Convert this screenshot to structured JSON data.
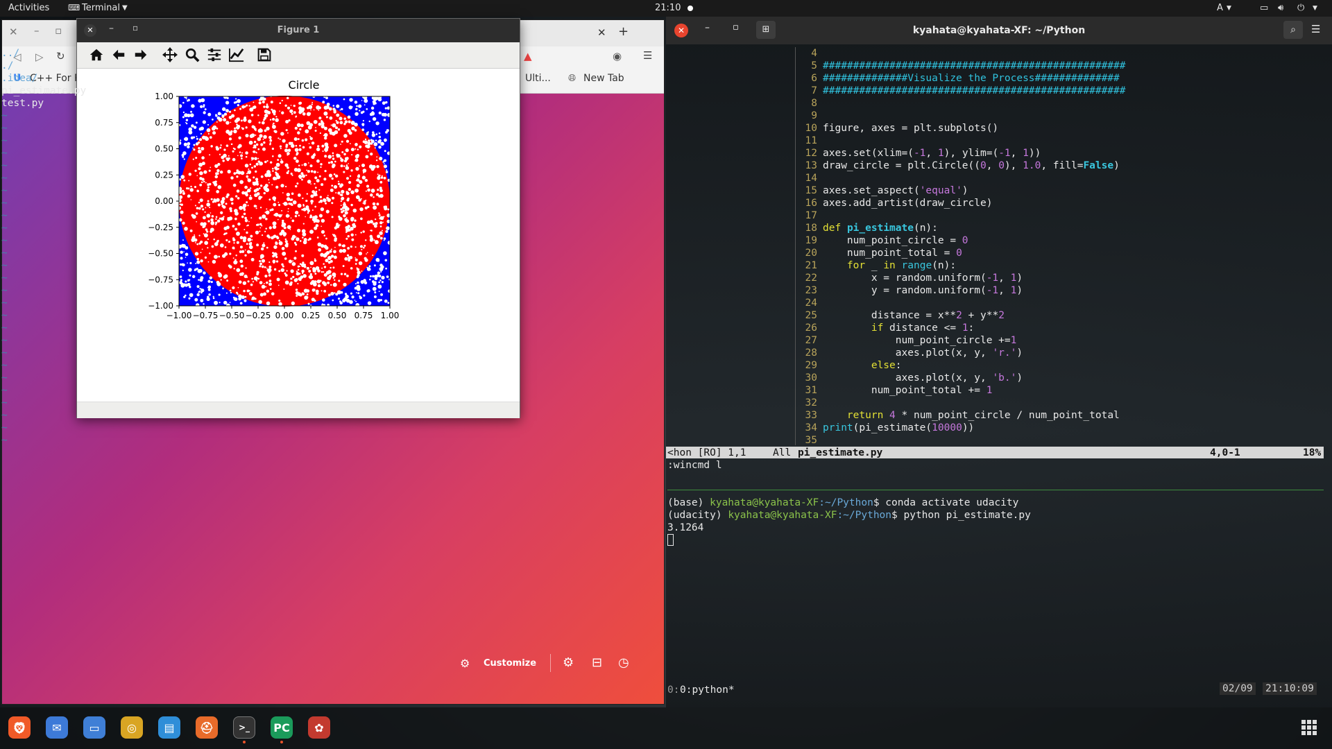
{
  "topbar": {
    "activities": "Activities",
    "app_menu": "Terminal",
    "clock": "21:10",
    "input_method": "A"
  },
  "dock": {
    "apps": [
      {
        "name": "brave",
        "color": "#f05a28"
      },
      {
        "name": "thunderbird",
        "color": "#3d7ad8"
      },
      {
        "name": "files",
        "color": "#3f7fd6"
      },
      {
        "name": "rhythmbox",
        "color": "#d9a523"
      },
      {
        "name": "libreoffice-writer",
        "color": "#2f8ed8"
      },
      {
        "name": "help",
        "color": "#e86b2a"
      },
      {
        "name": "terminal",
        "color": "#333333"
      },
      {
        "name": "pycharm",
        "color": "#1b9b5b"
      },
      {
        "name": "other",
        "color": "#c33a2f"
      }
    ]
  },
  "browser": {
    "bookmark_1": "C++ For Pr",
    "bookmark_2": "Ulti...",
    "new_tab": "New Tab",
    "customize": "Customize"
  },
  "figure": {
    "window_title": "Figure 1"
  },
  "chart_data": {
    "type": "scatter",
    "title": "Circle",
    "xlabel": "",
    "ylabel": "",
    "xlim": [
      -1.0,
      1.0
    ],
    "ylim": [
      -1.0,
      1.0
    ],
    "xticks": [
      "−1.00",
      "−0.75",
      "−0.50",
      "−0.25",
      "0.00",
      "0.25",
      "0.50",
      "0.75",
      "1.00"
    ],
    "yticks": [
      "1.00",
      "0.75",
      "0.50",
      "0.25",
      "0.00",
      "−0.25",
      "−0.50",
      "−0.75",
      "−1.00"
    ],
    "series": [
      {
        "color": "#ff0000",
        "region": "x^2 + y^2 <= 1"
      },
      {
        "color": "#0000ff",
        "region": "x^2 + y^2 > 1"
      }
    ],
    "grid": false,
    "aspect": "equal"
  },
  "terminal": {
    "title": "kyahata@kyahata-XF: ~/Python",
    "tree": [
      "../",
      "./",
      ".idea/",
      "pi_estimate.py",
      "test.py"
    ],
    "code_lines": [
      {
        "n": "4",
        "t": ""
      },
      {
        "n": "5",
        "t": "##################################################"
      },
      {
        "n": "6",
        "t": "##############Visualize the Process##############"
      },
      {
        "n": "7",
        "t": "##################################################"
      },
      {
        "n": "8",
        "t": ""
      },
      {
        "n": "9",
        "t": ""
      },
      {
        "n": "10",
        "t": "figure, axes = plt.subplots()"
      },
      {
        "n": "11",
        "t": ""
      },
      {
        "n": "12",
        "t": "axes.set(xlim=(-1, 1), ylim=(-1, 1))"
      },
      {
        "n": "13",
        "t": "draw_circle = plt.Circle((0, 0), 1.0, fill=False)"
      },
      {
        "n": "14",
        "t": ""
      },
      {
        "n": "15",
        "t": "axes.set_aspect('equal')"
      },
      {
        "n": "16",
        "t": "axes.add_artist(draw_circle)"
      },
      {
        "n": "17",
        "t": ""
      },
      {
        "n": "18",
        "t": "def pi_estimate(n):"
      },
      {
        "n": "19",
        "t": "    num_point_circle = 0"
      },
      {
        "n": "20",
        "t": "    num_point_total = 0"
      },
      {
        "n": "21",
        "t": "    for _ in range(n):"
      },
      {
        "n": "22",
        "t": "        x = random.uniform(-1, 1)"
      },
      {
        "n": "23",
        "t": "        y = random.uniform(-1, 1)"
      },
      {
        "n": "24",
        "t": ""
      },
      {
        "n": "25",
        "t": "        distance = x**2 + y**2"
      },
      {
        "n": "26",
        "t": "        if distance <= 1:"
      },
      {
        "n": "27",
        "t": "            num_point_circle +=1"
      },
      {
        "n": "28",
        "t": "            axes.plot(x, y, 'r.')"
      },
      {
        "n": "29",
        "t": "        else:"
      },
      {
        "n": "30",
        "t": "            axes.plot(x, y, 'b.')"
      },
      {
        "n": "31",
        "t": "        num_point_total += 1"
      },
      {
        "n": "32",
        "t": ""
      },
      {
        "n": "33",
        "t": "    return 4 * num_point_circle / num_point_total"
      },
      {
        "n": "34",
        "t": "print(pi_estimate(10000))"
      },
      {
        "n": "35",
        "t": ""
      }
    ],
    "status_left": "<hon [RO] 1,1",
    "status_all": "All",
    "status_file": "pi_estimate.py",
    "status_pos": "4,0-1",
    "status_pct": "18%",
    "wincmd": ":wincmd l",
    "shell": [
      {
        "env": "(base) ",
        "user": "kyahata@kyahata-XF",
        "path": ":~/Python",
        "cmd": "$ conda activate udacity"
      },
      {
        "env": "(udacity) ",
        "user": "kyahata@kyahata-XF",
        "path": ":~/Python",
        "cmd": "$ python pi_estimate.py"
      }
    ],
    "output": "3.1264",
    "tmux_window": "0:python*",
    "tmux_date": "02/09",
    "tmux_time": "21:10:09"
  }
}
